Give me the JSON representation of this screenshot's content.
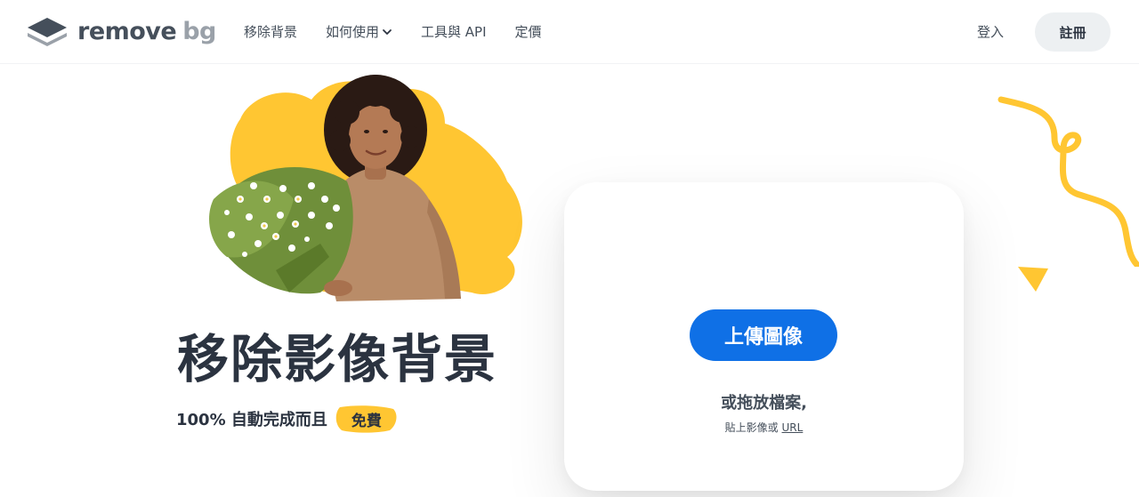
{
  "header": {
    "logo": {
      "word": "remove",
      "suffix": "bg"
    },
    "nav": [
      {
        "label": "移除背景"
      },
      {
        "label": "如何使用",
        "has_dropdown": true
      },
      {
        "label": "工具與 API"
      },
      {
        "label": "定價"
      }
    ],
    "login_label": "登入",
    "signup_label": "註冊"
  },
  "hero": {
    "title": "移除影像背景",
    "subtitle": "100% 自動完成而且",
    "free_badge": "免費"
  },
  "upload": {
    "button_label": "上傳圖像",
    "drop_text": "或拖放檔案,",
    "paste_prefix": "貼上影像或",
    "url_link": "URL"
  },
  "colors": {
    "accent_blue": "#0f70e6",
    "yellow": "#ffc632",
    "text_dark": "#2b3340",
    "text": "#454f5b"
  }
}
